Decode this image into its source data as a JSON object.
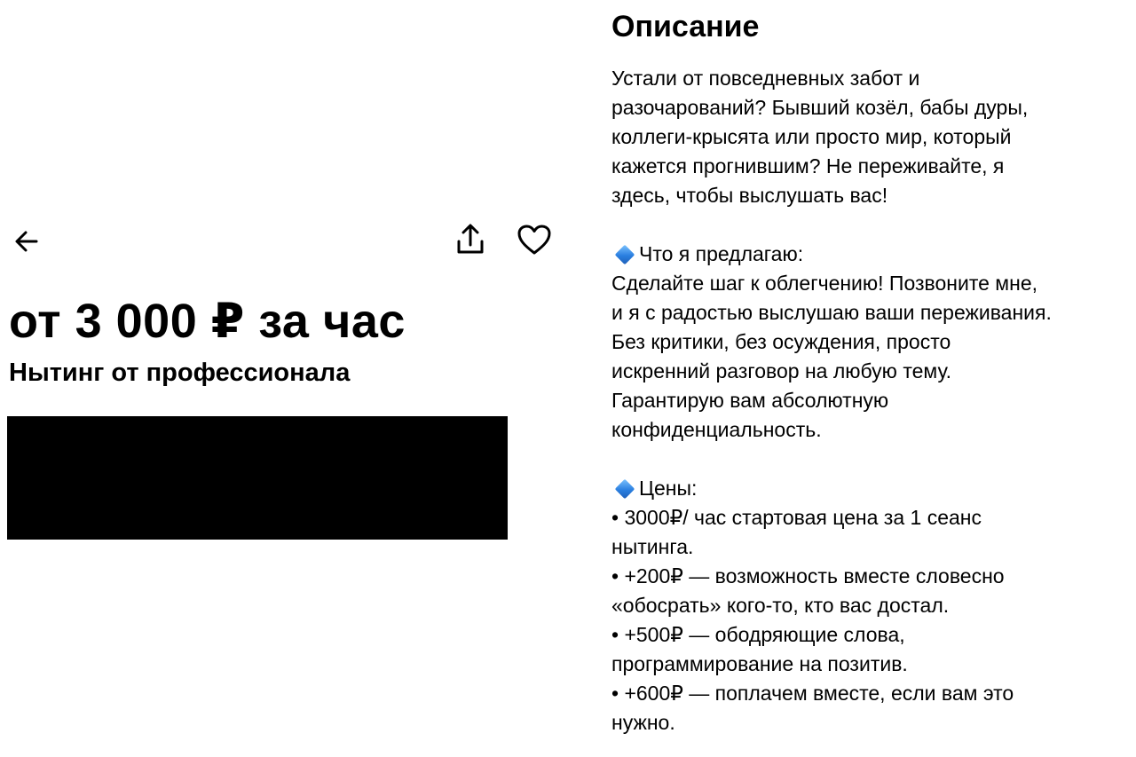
{
  "header": {
    "back_icon": "arrow-left-icon",
    "share_icon": "share-upload-icon",
    "favorite_icon": "heart-outline-icon"
  },
  "listing": {
    "price": "от 3 000 ₽ за час",
    "title": "Нытинг от профессионала"
  },
  "description": {
    "heading": "Описание",
    "intro_lines": [
      "Устали от повседневных забот и",
      "разочарований? Бывший козёл, бабы дуры,",
      "коллеги-крысята или просто мир, который",
      "кажется прогнившим? Не переживайте, я",
      "здесь, чтобы выслушать вас!"
    ],
    "offer_heading": "Что я предлагаю:",
    "offer_lines": [
      "Сделайте шаг к облегчению! Позвоните мне,",
      "и я с радостью выслушаю ваши переживания.",
      "Без критики, без осуждения, просто",
      "искренний разговор на любую тему.",
      "Гарантирую вам абсолютную",
      "конфиденциальность."
    ],
    "prices_heading": "Цены:",
    "price_lines": [
      "• 3000₽/ час стартовая цена за 1 сеанс",
      "нытинга.",
      "• +200₽ — возможность вместе словесно",
      "«обосрать» кого-то, кто вас достал.",
      "• +500₽ — ободряющие слова,",
      "программирование на позитив.",
      "• +600₽ — поплачем вместе, если вам это",
      "нужно."
    ],
    "bullet_icon": "blue-diamond-icon"
  },
  "colors": {
    "text": "#000000",
    "background": "#ffffff",
    "diamond": "#2a7fe0"
  }
}
